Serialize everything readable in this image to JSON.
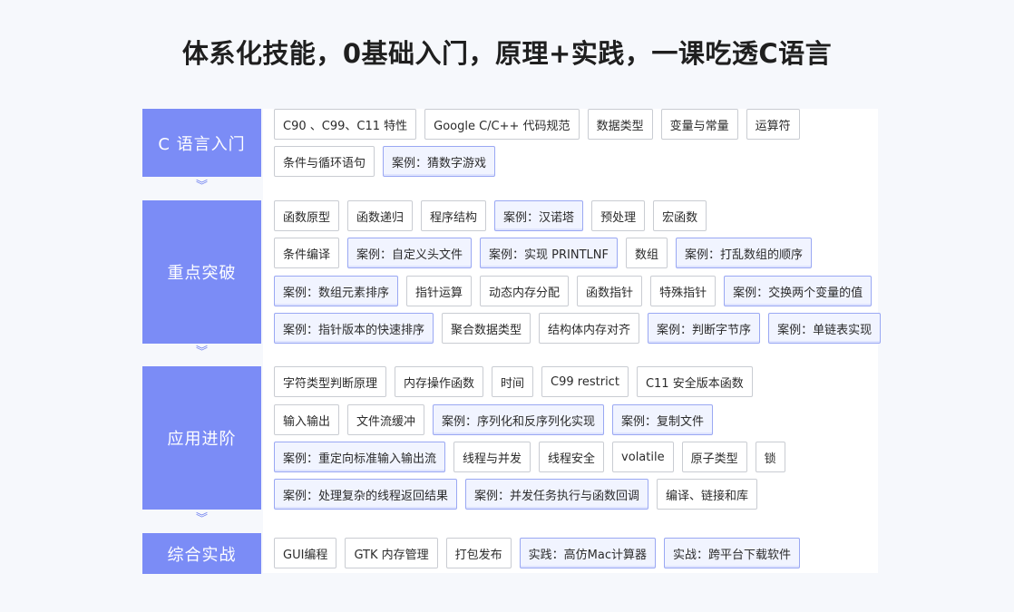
{
  "page": {
    "title": "体系化技能，0基础入门，原理+实践，一课吃透C语言"
  },
  "colors": {
    "section_bg": "#7b8cf6",
    "arrow": "#6f81ef",
    "case_border": "#9aa8f3",
    "tag_border": "#c9ccd2"
  },
  "arrow_glyph": "︾",
  "sections": [
    {
      "label": "C 语言入门",
      "rows": [
        [
          {
            "text": "C90 、C99、C11 特性",
            "case": false
          },
          {
            "text": "Google C/C++ 代码规范",
            "case": false
          },
          {
            "text": "数据类型",
            "case": false
          },
          {
            "text": "变量与常量",
            "case": false
          },
          {
            "text": "运算符",
            "case": false
          }
        ],
        [
          {
            "text": "条件与循环语句",
            "case": false
          },
          {
            "text": "案例：猜数字游戏",
            "case": true
          }
        ]
      ]
    },
    {
      "label": "重点突破",
      "rows": [
        [
          {
            "text": "函数原型",
            "case": false
          },
          {
            "text": "函数递归",
            "case": false
          },
          {
            "text": "程序结构",
            "case": false
          },
          {
            "text": "案例：汉诺塔",
            "case": true
          },
          {
            "text": "预处理",
            "case": false
          },
          {
            "text": "宏函数",
            "case": false
          }
        ],
        [
          {
            "text": "条件编译",
            "case": false
          },
          {
            "text": "案例：自定义头文件",
            "case": true
          },
          {
            "text": "案例：实现 PRINTLNF",
            "case": true
          },
          {
            "text": "数组",
            "case": false
          },
          {
            "text": "案例：打乱数组的顺序",
            "case": true
          }
        ],
        [
          {
            "text": "案例：数组元素排序",
            "case": true
          },
          {
            "text": "指针运算",
            "case": false
          },
          {
            "text": "动态内存分配",
            "case": false
          },
          {
            "text": "函数指针",
            "case": false
          },
          {
            "text": "特殊指针",
            "case": false
          },
          {
            "text": "案例：交换两个变量的值",
            "case": true
          }
        ],
        [
          {
            "text": "案例：指针版本的快速排序",
            "case": true
          },
          {
            "text": "聚合数据类型",
            "case": false
          },
          {
            "text": "结构体内存对齐",
            "case": false
          },
          {
            "text": "案例：判断字节序",
            "case": true
          },
          {
            "text": "案例：单链表实现",
            "case": true
          }
        ]
      ]
    },
    {
      "label": "应用进阶",
      "rows": [
        [
          {
            "text": "字符类型判断原理",
            "case": false
          },
          {
            "text": "内存操作函数",
            "case": false
          },
          {
            "text": "时间",
            "case": false
          },
          {
            "text": "C99 restrict",
            "case": false
          },
          {
            "text": "C11 安全版本函数",
            "case": false
          }
        ],
        [
          {
            "text": "输入输出",
            "case": false
          },
          {
            "text": "文件流缓冲",
            "case": false
          },
          {
            "text": "案例：序列化和反序列化实现",
            "case": true
          },
          {
            "text": "案例：复制文件",
            "case": true
          }
        ],
        [
          {
            "text": "案例：重定向标准输入输出流",
            "case": true
          },
          {
            "text": "线程与并发",
            "case": false
          },
          {
            "text": "线程安全",
            "case": false
          },
          {
            "text": "volatile",
            "case": false
          },
          {
            "text": "原子类型",
            "case": false
          },
          {
            "text": "锁",
            "case": false
          }
        ],
        [
          {
            "text": "案例：处理复杂的线程返回结果",
            "case": true
          },
          {
            "text": "案例：并发任务执行与函数回调",
            "case": true
          },
          {
            "text": "编译、链接和库",
            "case": false
          }
        ]
      ]
    },
    {
      "label": "综合实战",
      "rows": [
        [
          {
            "text": "GUI编程",
            "case": false
          },
          {
            "text": "GTK 内存管理",
            "case": false
          },
          {
            "text": "打包发布",
            "case": false
          },
          {
            "text": "实践：高仿Mac计算器",
            "case": true
          },
          {
            "text": "实战：跨平台下载软件",
            "case": true
          }
        ]
      ]
    }
  ]
}
